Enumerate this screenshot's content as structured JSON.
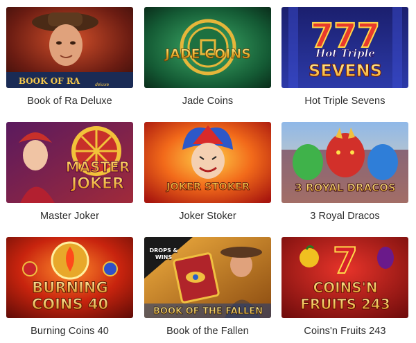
{
  "games": [
    {
      "title": "Book of Ra Deluxe",
      "logo": "BOOK OF RA",
      "logo_sub": "deluxe"
    },
    {
      "title": "Jade Coins",
      "logo": "JADE COINS"
    },
    {
      "title": "Hot Triple Sevens",
      "logo_top": "Hot Triple",
      "logo": "SEVENS"
    },
    {
      "title": "Master Joker",
      "logo_top": "MASTER",
      "logo": "JOKER"
    },
    {
      "title": "Joker Stoker",
      "logo": "JOKER STOKER"
    },
    {
      "title": "3 Royal Dracos",
      "logo": "3 ROYAL DRACOS"
    },
    {
      "title": "Burning Coins 40",
      "logo_top": "BURNING",
      "logo": "COINS 40"
    },
    {
      "title": "Book of the Fallen",
      "logo": "BOOK OF THE FALLEN",
      "badge": "DROPS & WINS"
    },
    {
      "title": "Coins'n Fruits 243",
      "logo_top": "COINS'N",
      "logo": "FRUITS 243"
    }
  ],
  "colors": {
    "title_text": "#2b2b2b",
    "background": "#ffffff"
  }
}
